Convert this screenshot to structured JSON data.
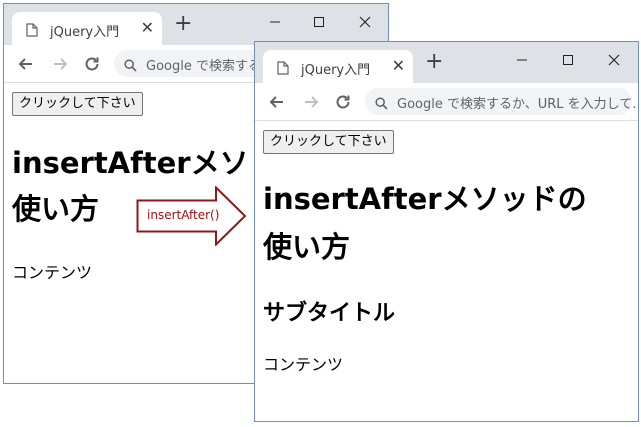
{
  "windows": {
    "before": {
      "tab_title": "jQuery入門",
      "omnibox_text": "Google で検索する",
      "button_label": "クリックして下さい",
      "heading_line1": "insertAfterメソ",
      "heading_line2": "使い方",
      "paragraph": "コンテンツ"
    },
    "after": {
      "tab_title": "jQuery入門",
      "omnibox_text": "Google で検索するか、URL を入力して…",
      "button_label": "クリックして下さい",
      "heading_line1": "insertAfterメソッドの",
      "heading_line2": "使い方",
      "subtitle": "サブタイトル",
      "paragraph": "コンテンツ"
    }
  },
  "annotation": {
    "label": "insertAfter()",
    "color": "#a01010"
  },
  "icons": {
    "tab": "page-icon",
    "close": "close-icon",
    "new_tab": "plus-icon",
    "back": "arrow-left-icon",
    "forward": "arrow-right-icon",
    "reload": "reload-icon",
    "search": "search-icon",
    "minimize": "minimize-icon",
    "maximize": "maximize-icon",
    "window_close": "window-close-icon"
  }
}
